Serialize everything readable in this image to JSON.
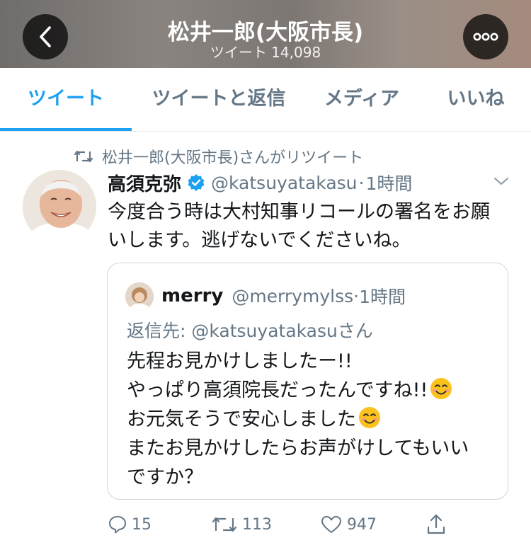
{
  "header": {
    "title": "松井一郎(大阪市長)",
    "subtitle": "ツイート 14,098",
    "back_icon": "chevron-left-icon",
    "more_icon": "ellipsis-icon"
  },
  "tabs": [
    {
      "label": "ツイート",
      "active": true
    },
    {
      "label": "ツイートと返信",
      "active": false
    },
    {
      "label": "メディア",
      "active": false
    },
    {
      "label": "いいね",
      "active": false
    }
  ],
  "tweet": {
    "retweet_context": "松井一郎(大阪市長)さんがリツイート",
    "author_name": "高須克弥",
    "handle": "@katsuyatakasu",
    "separator": "·",
    "time": "1時間",
    "text_line1": "今度合う時は大村知事リコールの署名をお願",
    "text_line2": "いします。逃げないでくださいね。",
    "verified": true,
    "quote": {
      "author_name": "merry",
      "handle": "@merrymylss",
      "separator": "·",
      "time": "1時間",
      "reply_prefix": "返信先: ",
      "reply_handle": "@katsuyatakasu",
      "reply_suffix": "さん",
      "line1": "先程お見かけしましたー!!",
      "line2": "やっぱり高須院長だったんですね!!",
      "line3": "お元気そうで安心しました",
      "line4": "またお見かけしたらお声がけしてもいい",
      "line5": "ですか？"
    },
    "actions": {
      "reply_count": "15",
      "retweet_count": "113",
      "like_count": "947"
    }
  },
  "colors": {
    "accent": "#1da1f2",
    "secondary_text": "#657786",
    "border": "#ccd6dd"
  }
}
